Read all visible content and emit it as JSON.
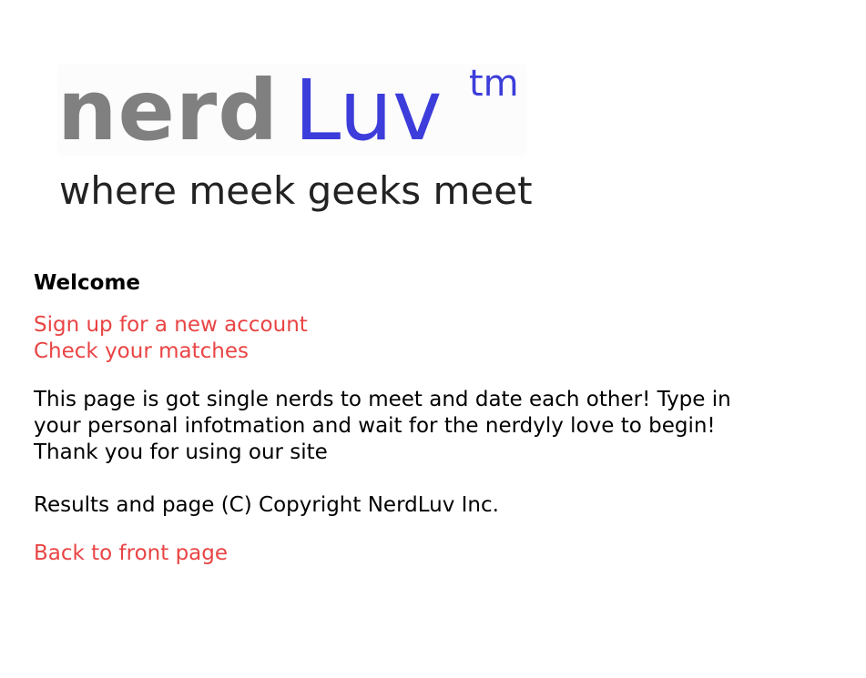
{
  "logo": {
    "nerd_text": "nerd",
    "luv_text": "Luv",
    "tm_text": "tm",
    "tagline": "where meek geeks meet"
  },
  "welcome": {
    "heading": "Welcome"
  },
  "links": {
    "signup": "Sign up for a new account",
    "matches": "Check your matches",
    "back": "Back to front page"
  },
  "intro": {
    "line1": "This page is got single nerds to meet and date each other! Type in",
    "line2": "your personal infotmation and wait for the nerdyly love to begin!",
    "line3": "Thank you for using our site"
  },
  "copyright": "Results and page (C) Copyright NerdLuv Inc.",
  "colors": {
    "link": "#e94444",
    "logo_gray": "#808080",
    "logo_blue": "#3d3ddb"
  }
}
